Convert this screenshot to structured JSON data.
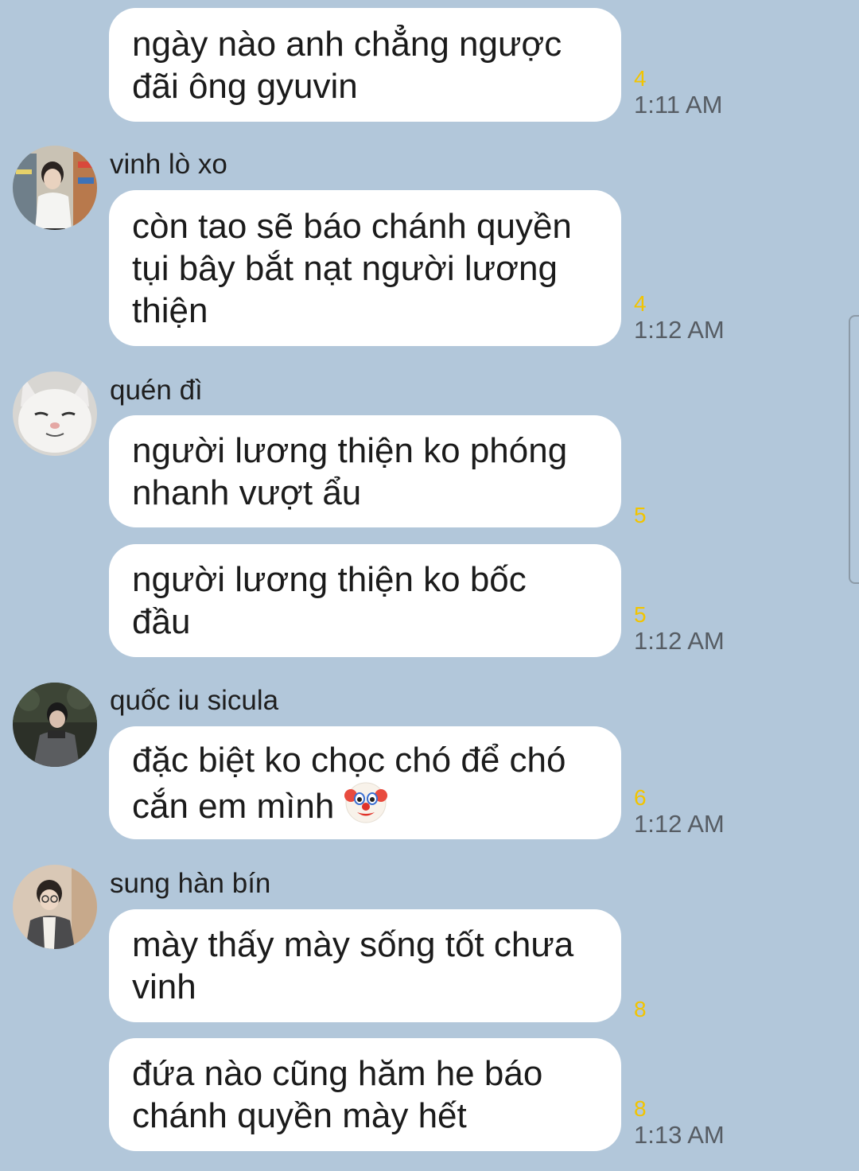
{
  "messages": [
    {
      "text": "ngày nào anh chẳng ngược\nđãi ông gyuvin",
      "count": "4",
      "time": "1:11 AM"
    },
    {
      "sender": "vinh lò xo",
      "text": "còn tao sẽ báo chánh quyền\ntụi bây bắt nạt người lương\nthiện",
      "count": "4",
      "time": "1:12 AM"
    },
    {
      "sender": "quén đì",
      "text": "người lương thiện ko phóng\nnhanh vượt ẩu",
      "count": "5"
    },
    {
      "text": "người lương thiện ko bốc\nđầu",
      "count": "5",
      "time": "1:12 AM"
    },
    {
      "sender": "quốc iu sicula",
      "text_line1": "đặc biệt ko chọc chó để chó",
      "text_line2": "cắn em mình",
      "emoji": "clown-face",
      "count": "6",
      "time": "1:12 AM"
    },
    {
      "sender": "sung hàn bín",
      "text": "mày thấy mày sống tốt chưa\nvinh",
      "count": "8"
    },
    {
      "text": "đứa nào cũng hăm he báo\nchánh quyền mày hết",
      "count": "8",
      "time": "1:13 AM"
    }
  ],
  "colors": {
    "background": "#b2c7da",
    "bubble": "#ffffff",
    "unread_count": "#f2c400",
    "time": "#565c63"
  }
}
